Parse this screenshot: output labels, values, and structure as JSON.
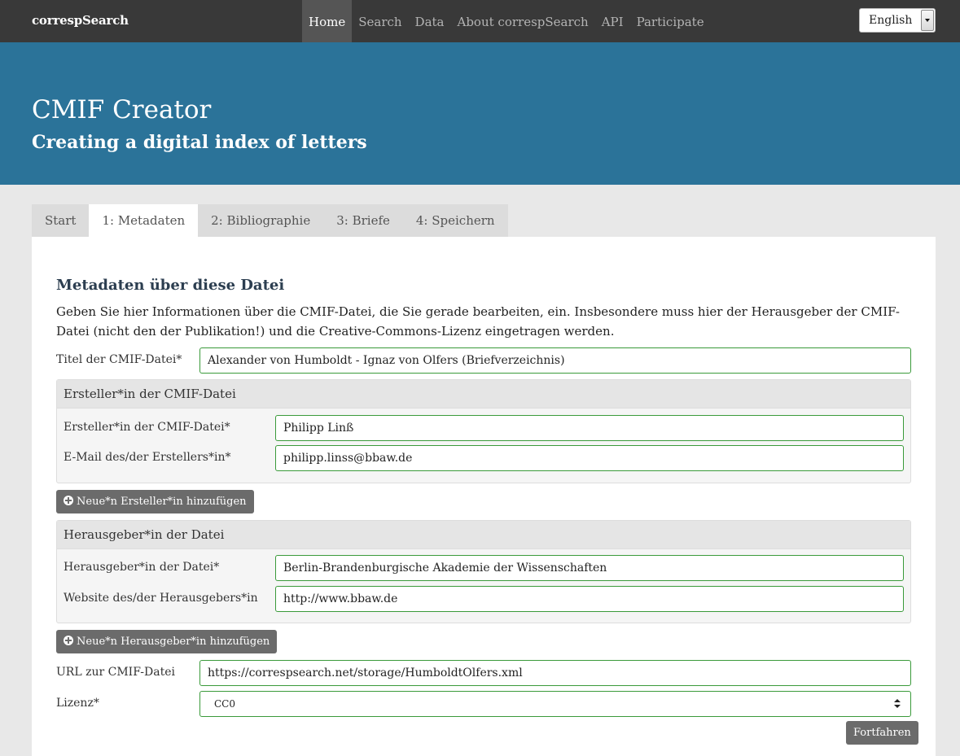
{
  "navbar": {
    "brand": "correspSearch",
    "links": [
      "Home",
      "Search",
      "Data",
      "About correspSearch",
      "API",
      "Participate"
    ],
    "language": "English"
  },
  "hero": {
    "title": "CMIF Creator",
    "subtitle": "Creating a digital index of letters"
  },
  "tabs": [
    "Start",
    "1: Metadaten",
    "2: Bibliographie",
    "3: Briefe",
    "4: Speichern"
  ],
  "form": {
    "heading": "Metadaten über diese Datei",
    "intro": "Geben Sie hier Informationen über die CMIF-Datei, die Sie gerade bearbeiten, ein. Insbesondere muss hier der Herausgeber der CMIF-Datei (nicht den der Publikation!) und die Creative-Commons-Lizenz eingetragen werden.",
    "title_label": "Titel der CMIF-Datei*",
    "title_value": "Alexander von Humboldt - Ignaz von Olfers (Briefverzeichnis)",
    "creator_panel": {
      "heading": "Ersteller*in der CMIF-Datei",
      "name_label": "Ersteller*in der CMIF-Datei*",
      "name_value": "Philipp Linß",
      "email_label": "E-Mail des/der Erstellers*in*",
      "email_value": "philipp.linss@bbaw.de"
    },
    "add_creator_button": "Neue*n Ersteller*in hinzufügen",
    "publisher_panel": {
      "heading": "Herausgeber*in der Datei",
      "name_label": "Herausgeber*in der Datei*",
      "name_value": "Berlin-Brandenburgische Akademie der Wissenschaften",
      "website_label": "Website des/der Herausgebers*in",
      "website_value": "http://www.bbaw.de"
    },
    "add_publisher_button": "Neue*n Herausgeber*in hinzufügen",
    "url_label": "URL zur CMIF-Datei",
    "url_value": "https://correspsearch.net/storage/HumboldtOlfers.xml",
    "license_label": "Lizenz*",
    "license_value": "CC0",
    "continue_button": "Fortfahren"
  }
}
